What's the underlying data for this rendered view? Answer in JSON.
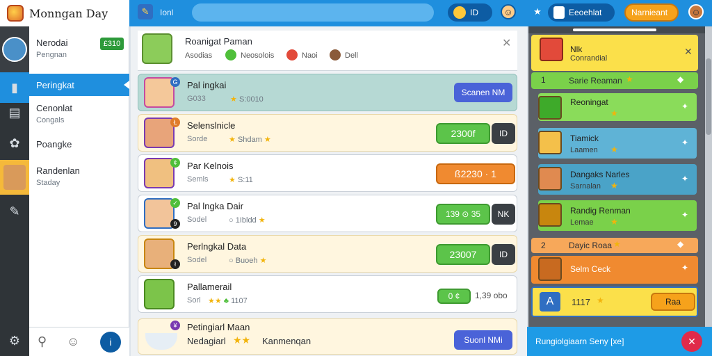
{
  "app": {
    "title": "Monngan Day"
  },
  "topbar": {
    "nav_label": "Ionl",
    "search_placeholder": "",
    "coins": "ID",
    "notif_label": "Eeoehlat",
    "action_label": "Narnieant"
  },
  "sidebar": {
    "profile": {
      "name": "Nerodai",
      "sub": "Pengnan",
      "badge": "£310"
    },
    "items": [
      {
        "label": "Peringkat",
        "sub": ""
      },
      {
        "label": "Cenonlat",
        "sub": "Congals"
      },
      {
        "label": "Poangke",
        "sub": ""
      },
      {
        "label": "Randenlan",
        "sub": "Staday"
      }
    ]
  },
  "content": {
    "header": {
      "title": "Roanigat Paman",
      "stat1": "Asodias",
      "stat2": "Neosolois",
      "stat3": "Naoi",
      "stat4": "Dell"
    },
    "rows": [
      {
        "name": "Pal ingkai",
        "sub": "G033",
        "score": "S:0010",
        "action": "Scanen NM",
        "badge": "G"
      },
      {
        "name": "Selenslnicle",
        "sub": "Sorde",
        "score": "Shdam",
        "action": "2300f",
        "extra": "ID",
        "badge": "Ł"
      },
      {
        "name": "Par Kelnois",
        "sub": "Semls",
        "score": "S:11",
        "action": "ß2230 · 1",
        "badge": "¢"
      },
      {
        "name": "Pal lngka Dair",
        "sub": "Sodel",
        "score": "1Ibldd",
        "action": "139 ⊙ 35",
        "extra": "NK",
        "badge": "9"
      },
      {
        "name": "Perlngkal Data",
        "sub": "Sodel",
        "score": "Buoeh",
        "action": "23007",
        "extra": "ID",
        "badge": "ł"
      },
      {
        "name": "Pallamerail",
        "sub": "Sorl",
        "score": "1107",
        "action": "0 ¢",
        "extra": "1,39 obo",
        "badge": ""
      },
      {
        "name": "Petingiarl Maan",
        "sub": "Nedagiarl",
        "score": "Kanmenqan",
        "action": "Suonl NMi",
        "badge": "¥"
      }
    ]
  },
  "rpanel": {
    "header": {
      "title": "Nlk",
      "sub": "Conrandial"
    },
    "section1": {
      "rank": "1",
      "label": "Sarie Reaman"
    },
    "items": [
      {
        "label": "Reoningat",
        "sub": ""
      },
      {
        "label": "Tiamick",
        "sub": "Laamen"
      },
      {
        "label": "Dangaks Narles",
        "sub": "Sarnalan"
      },
      {
        "label": "Randig Renman",
        "sub": "Lemae"
      }
    ],
    "section2": {
      "rank": "2",
      "label": "Dayic Roaa"
    },
    "item5": {
      "label": "Selm Ceck"
    },
    "footer": {
      "score": "1117",
      "button": "Raa"
    }
  },
  "toast": {
    "text": "Rungiolgiaarn Seny [xe]"
  },
  "colors": {
    "topbar": "#1f8fde",
    "active": "#1f8fde",
    "green": "#5cc44a",
    "orange": "#f08a30",
    "blue_btn": "#4a63d8"
  }
}
